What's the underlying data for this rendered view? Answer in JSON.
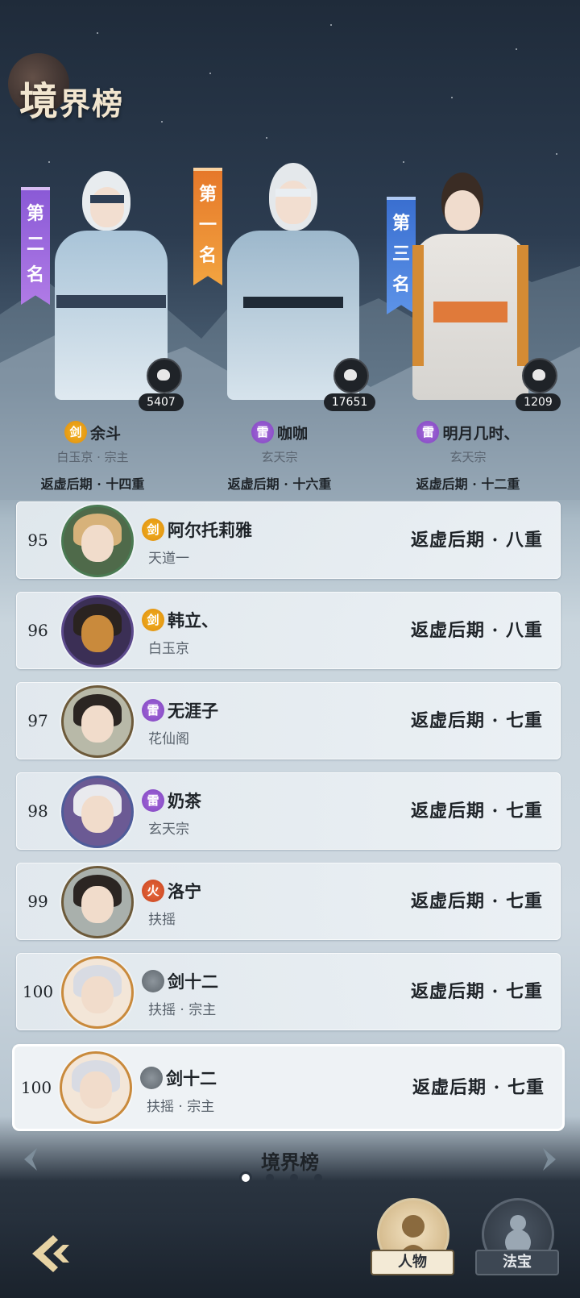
{
  "header": {
    "title_big": "境",
    "title_small": "界榜"
  },
  "podium": [
    {
      "rank_label": "第二名",
      "name": "余斗",
      "element": "剑",
      "element_type": "jian",
      "sect": "白玉京 · 宗主",
      "level": "返虚后期 · 十四重",
      "score": "5407"
    },
    {
      "rank_label": "第一名",
      "name": "咖咖",
      "element": "雷",
      "element_type": "lei",
      "sect": "玄天宗",
      "level": "返虚后期 · 十六重",
      "score": "17651"
    },
    {
      "rank_label": "第三名",
      "name": "明月几时、",
      "element": "雷",
      "element_type": "lei",
      "sect": "玄天宗",
      "level": "返虚后期 · 十二重",
      "score": "1209"
    }
  ],
  "rows": [
    {
      "rank": "95",
      "element": "剑",
      "element_type": "jian",
      "name": "阿尔托莉雅",
      "sect": "天道一",
      "level": "返虚后期 · 八重"
    },
    {
      "rank": "96",
      "element": "剑",
      "element_type": "jian",
      "name": "韩立、",
      "sect": "白玉京",
      "level": "返虚后期 · 八重"
    },
    {
      "rank": "97",
      "element": "雷",
      "element_type": "lei",
      "name": "无涯子",
      "sect": "花仙阁",
      "level": "返虚后期 · 七重"
    },
    {
      "rank": "98",
      "element": "雷",
      "element_type": "lei",
      "name": "奶茶",
      "sect": "玄天宗",
      "level": "返虚后期 · 七重"
    },
    {
      "rank": "99",
      "element": "火",
      "element_type": "huo",
      "name": "洛宁",
      "sect": "扶摇",
      "level": "返虚后期 · 七重"
    },
    {
      "rank": "100",
      "element": "",
      "element_type": "none",
      "name": "剑十二",
      "sect": "扶摇 · 宗主",
      "level": "返虚后期 · 七重"
    }
  ],
  "self_row": {
    "rank": "100",
    "element": "",
    "element_type": "none",
    "name": "剑十二",
    "sect": "扶摇 · 宗主",
    "level": "返虚后期 · 七重"
  },
  "footer": {
    "page_title": "境界榜",
    "page_index": 1,
    "page_count": 4,
    "tab_people": "人物",
    "tab_treasure": "法宝"
  },
  "colors": {
    "rank1": "#e6782a",
    "rank2": "#8a5ad6",
    "rank3": "#3a6fd0",
    "jian": "#de8e10",
    "lei": "#8146c2",
    "huo": "#c84520"
  }
}
